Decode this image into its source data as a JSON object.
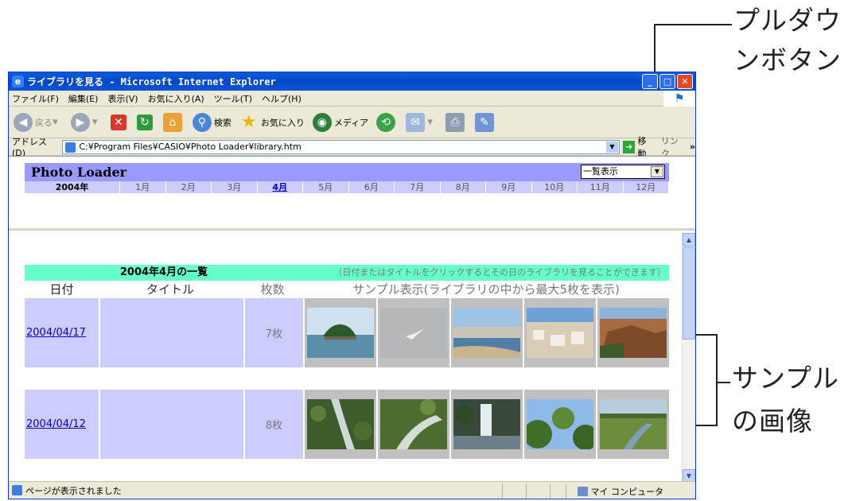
{
  "annotations": {
    "pulldown_line1": "プルダウ",
    "pulldown_line2": "ンボタン",
    "sample_line1": "サンプル",
    "sample_line2": "の画像"
  },
  "window": {
    "title": "ライブラリを見る - Microsoft Internet Explorer"
  },
  "menu": [
    "ファイル(F)",
    "編集(E)",
    "表示(V)",
    "お気に入り(A)",
    "ツール(T)",
    "ヘルプ(H)"
  ],
  "toolbar": {
    "back": "戻る",
    "search": "検索",
    "favorites": "お気に入り",
    "media": "メディア"
  },
  "addressbar": {
    "label": "アドレス(D)",
    "url": "C:¥Program Files¥CASIO¥Photo Loader¥library.htm",
    "go": "移動",
    "links": "リンク"
  },
  "app": {
    "title": "Photo Loader",
    "view_select": "一覧表示",
    "year": "2004年",
    "months": [
      "1月",
      "2月",
      "3月",
      "4月",
      "5月",
      "6月",
      "7月",
      "8月",
      "9月",
      "10月",
      "11月",
      "12月"
    ],
    "active_month": "4月"
  },
  "list": {
    "heading": "2004年4月の一覧",
    "note": "（日付またはタイトルをクリックするとその日のライブラリを見ることができます）",
    "columns": {
      "date": "日付",
      "title": "タイトル",
      "count": "枚数",
      "sample": "サンプル表示(ライブラリの中から最大5枚を表示)"
    },
    "rows": [
      {
        "date": "2004/04/17",
        "title": "",
        "count": "7枚"
      },
      {
        "date": "2004/04/12",
        "title": "",
        "count": "8枚"
      }
    ]
  },
  "status": {
    "text": "ページが表示されました",
    "zone": "マイ コンピュータ"
  },
  "colors": {
    "header_bar": "#9999ff",
    "month_bar": "#ccccff",
    "list_heading": "#66ffcc",
    "row_bg": "#ccccff"
  }
}
